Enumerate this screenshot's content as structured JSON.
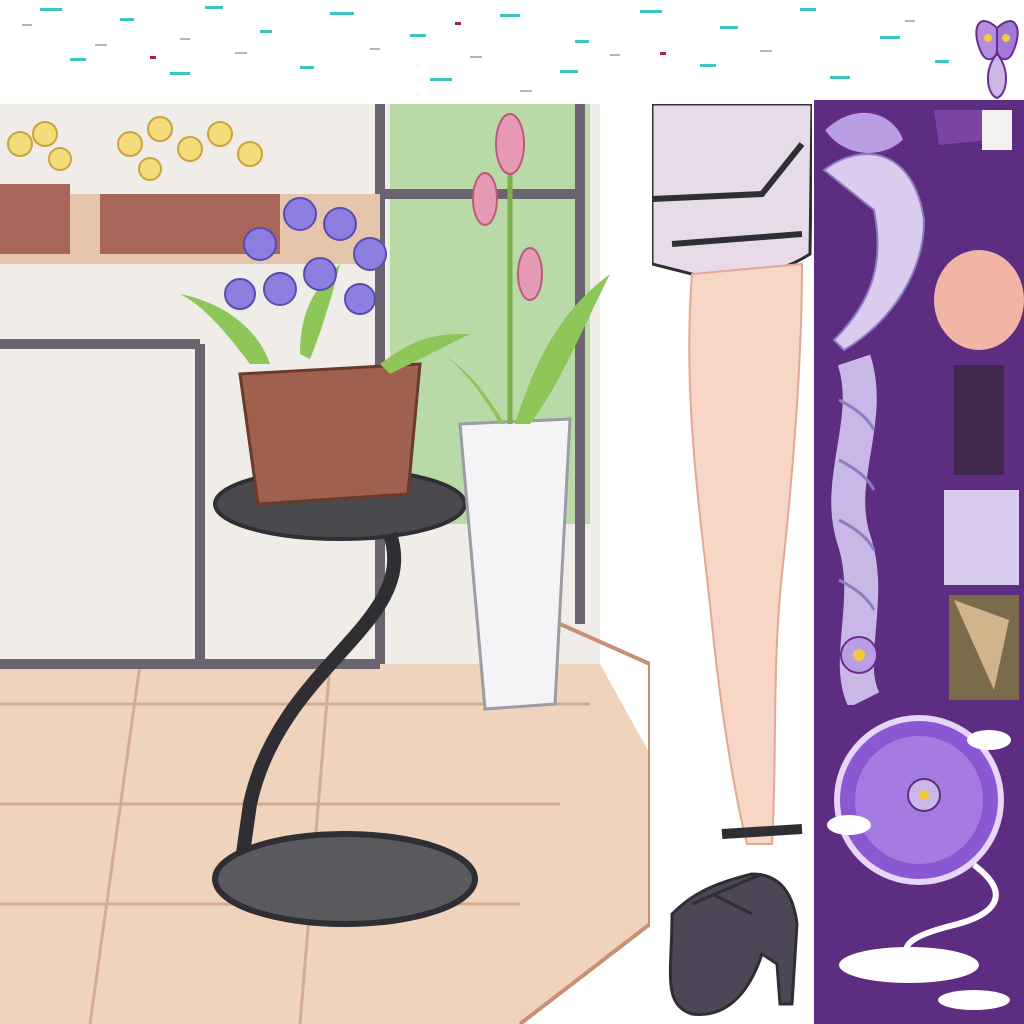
{
  "sprite_atlas": {
    "regions": [
      {
        "id": "speckle-strip",
        "content": "scattered-confetti-fragments"
      },
      {
        "id": "flower-shop-scene",
        "content": "flower-pots-on-stand-with-vase"
      },
      {
        "id": "leg-sprite",
        "content": "skirt-thigh-strap-leg-high-heel"
      },
      {
        "id": "butterfly-sprite",
        "content": "purple-butterfly"
      },
      {
        "id": "hair-pieces",
        "content": "lavender-hair-and-braid"
      },
      {
        "id": "purple-orb",
        "content": "purple-orb-with-clouds"
      }
    ]
  },
  "palette": {
    "purple": "#6a2c8e",
    "lavender": "#c9b8e6",
    "skin": "#f7d6c6",
    "wood": "#e9c1a7",
    "dark": "#2f2f33",
    "leaf": "#8ec65a"
  }
}
